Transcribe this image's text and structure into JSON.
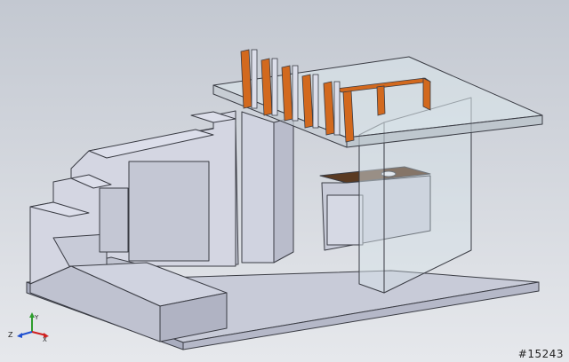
{
  "viewport": {
    "background_top": "#c3c8d1",
    "background_bottom": "#e6e8ec"
  },
  "model": {
    "wall_color": "#c8cbd8",
    "wall_dark": "#a9adbf",
    "wall_light": "#dcdeea",
    "edge_color": "#3a3c44",
    "beam_color": "#d2691e",
    "counter_color": "#5a3a22",
    "glass_color": "#d8e4ea"
  },
  "triad": {
    "x_label": "X",
    "y_label": "Y",
    "z_label": "Z",
    "x_icon": "x-axis-arrow-icon",
    "y_icon": "y-axis-arrow-icon",
    "z_icon": "z-axis-arrow-icon"
  },
  "watermark": {
    "text": "#15243"
  }
}
